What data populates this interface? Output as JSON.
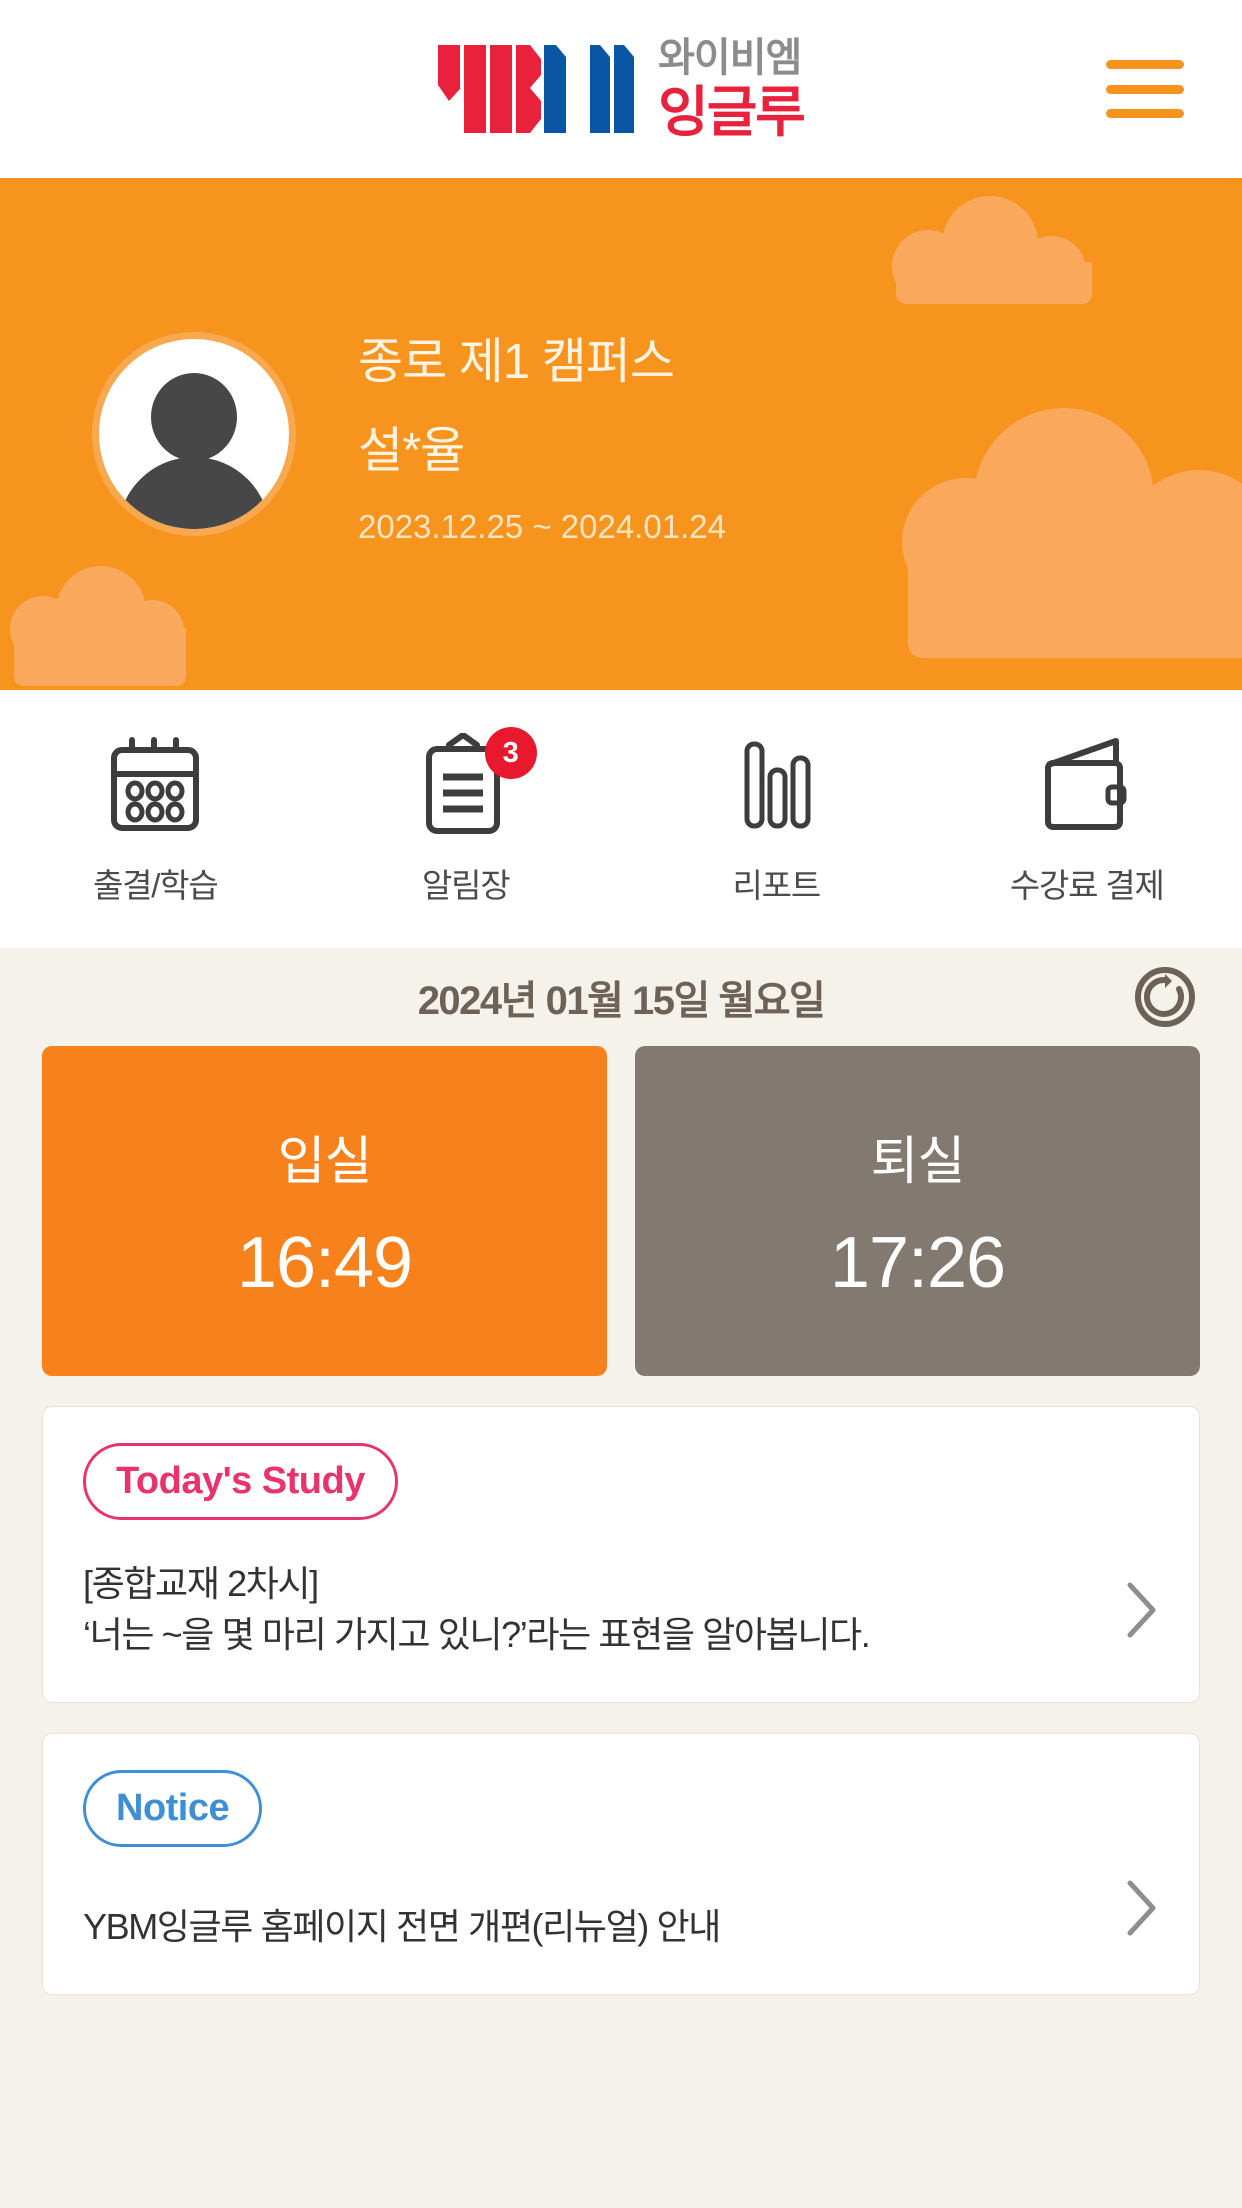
{
  "colors": {
    "brand_orange": "#F7941E",
    "card_orange": "#F7821B",
    "card_gray": "#827A70",
    "page_bg": "#F5F2EC",
    "badge_red": "#E8192C",
    "logo_red": "#E8213C",
    "logo_blue": "#0B56A4",
    "pill_pink": "#E8336D",
    "pill_blue": "#3E8FD4"
  },
  "header": {
    "logo_icon": "ybm-logo-mark",
    "logo_text_top": "와이비엠",
    "logo_text_bottom": "잉글루",
    "menu_icon": "hamburger-menu-icon"
  },
  "banner": {
    "avatar_icon": "user-avatar-placeholder",
    "campus": "종로 제1 캠퍼스",
    "student_name": "설*율",
    "period": "2023.12.25 ~ 2024.01.24"
  },
  "iconnav": {
    "items": [
      {
        "icon": "calendar-icon",
        "label": "출결/학습",
        "badge": null
      },
      {
        "icon": "clipboard-icon",
        "label": "알림장",
        "badge": "3"
      },
      {
        "icon": "bar-chart-icon",
        "label": "리포트",
        "badge": null
      },
      {
        "icon": "wallet-icon",
        "label": "수강료 결제",
        "badge": null
      }
    ]
  },
  "attendance": {
    "date_text": "2024년 01월 15일 월요일",
    "refresh_icon": "refresh-icon",
    "check_in": {
      "label": "입실",
      "time": "16:49"
    },
    "check_out": {
      "label": "퇴실",
      "time": "17:26"
    }
  },
  "study_card": {
    "pill_label": "Today's Study",
    "line1": "[종합교재 2차시]",
    "line2": "‘너는 ~을 몇 마리 가지고 있니?’라는 표현을 알아봅니다.",
    "chevron_icon": "chevron-right-icon"
  },
  "notice_card": {
    "pill_label": "Notice",
    "title": "YBM잉글루 홈페이지 전면 개편(리뉴얼) 안내",
    "chevron_icon": "chevron-right-icon"
  }
}
